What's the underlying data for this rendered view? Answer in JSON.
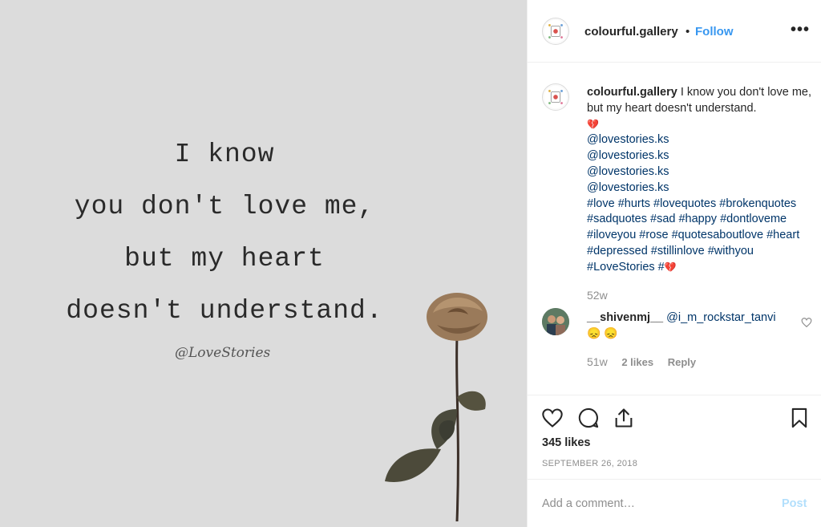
{
  "post_image": {
    "quote_lines": [
      "I know",
      "you don't love me,",
      "but my heart",
      "doesn't understand."
    ],
    "signature": "@LoveStories"
  },
  "header": {
    "username": "colourful.gallery",
    "separator": "•",
    "follow_label": "Follow",
    "more_label": "•••"
  },
  "caption": {
    "username": "colourful.gallery",
    "text": "I know you don't love me, but my heart doesn't understand.",
    "emoji": "💔",
    "mentions": [
      "@lovestories.ks",
      "@lovestories.ks",
      "@lovestories.ks",
      "@lovestories.ks"
    ],
    "hashtags": "#love #hurts #lovequotes #brokenquotes #sadquotes #sad #happy #dontloveme #iloveyou #rose #quotesaboutlove #heart #depressed #stillinlove #withyou #LoveStories #",
    "end_emoji": "💔",
    "time": "52w"
  },
  "comment": {
    "username": "__shivenmj__",
    "mention": "@i_m_rockstar_tanvi",
    "emojis": "😞 😞",
    "time": "51w",
    "likes": "2 likes",
    "reply_label": "Reply"
  },
  "actions": {
    "likes_count": "345 likes",
    "date": "SEPTEMBER 26, 2018"
  },
  "add_comment": {
    "placeholder": "Add a comment…",
    "post_label": "Post"
  },
  "colors": {
    "accent": "#3897f0",
    "link": "#003569",
    "muted": "#8e8e8e",
    "image_bg": "#dcdcdc"
  }
}
